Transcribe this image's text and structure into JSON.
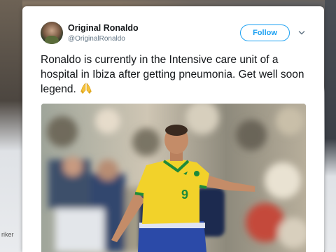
{
  "background": {
    "snippet": "riker"
  },
  "tweet": {
    "display_name": "Original Ronaldo",
    "handle": "@OriginalRonaldo",
    "follow_label": "Follow",
    "text": "Ronaldo is currently in the Intensive care unit of a hospital in Ibiza after getting pneumonia. Get well soon legend.",
    "emoji_icon": "folded-hands-icon",
    "media": {
      "jersey_number": "9"
    }
  },
  "colors": {
    "accent": "#1da1f2",
    "text": "#14171a",
    "muted": "#657786",
    "jersey_yellow": "#f2d22a",
    "shorts_blue": "#2b4aa8"
  }
}
